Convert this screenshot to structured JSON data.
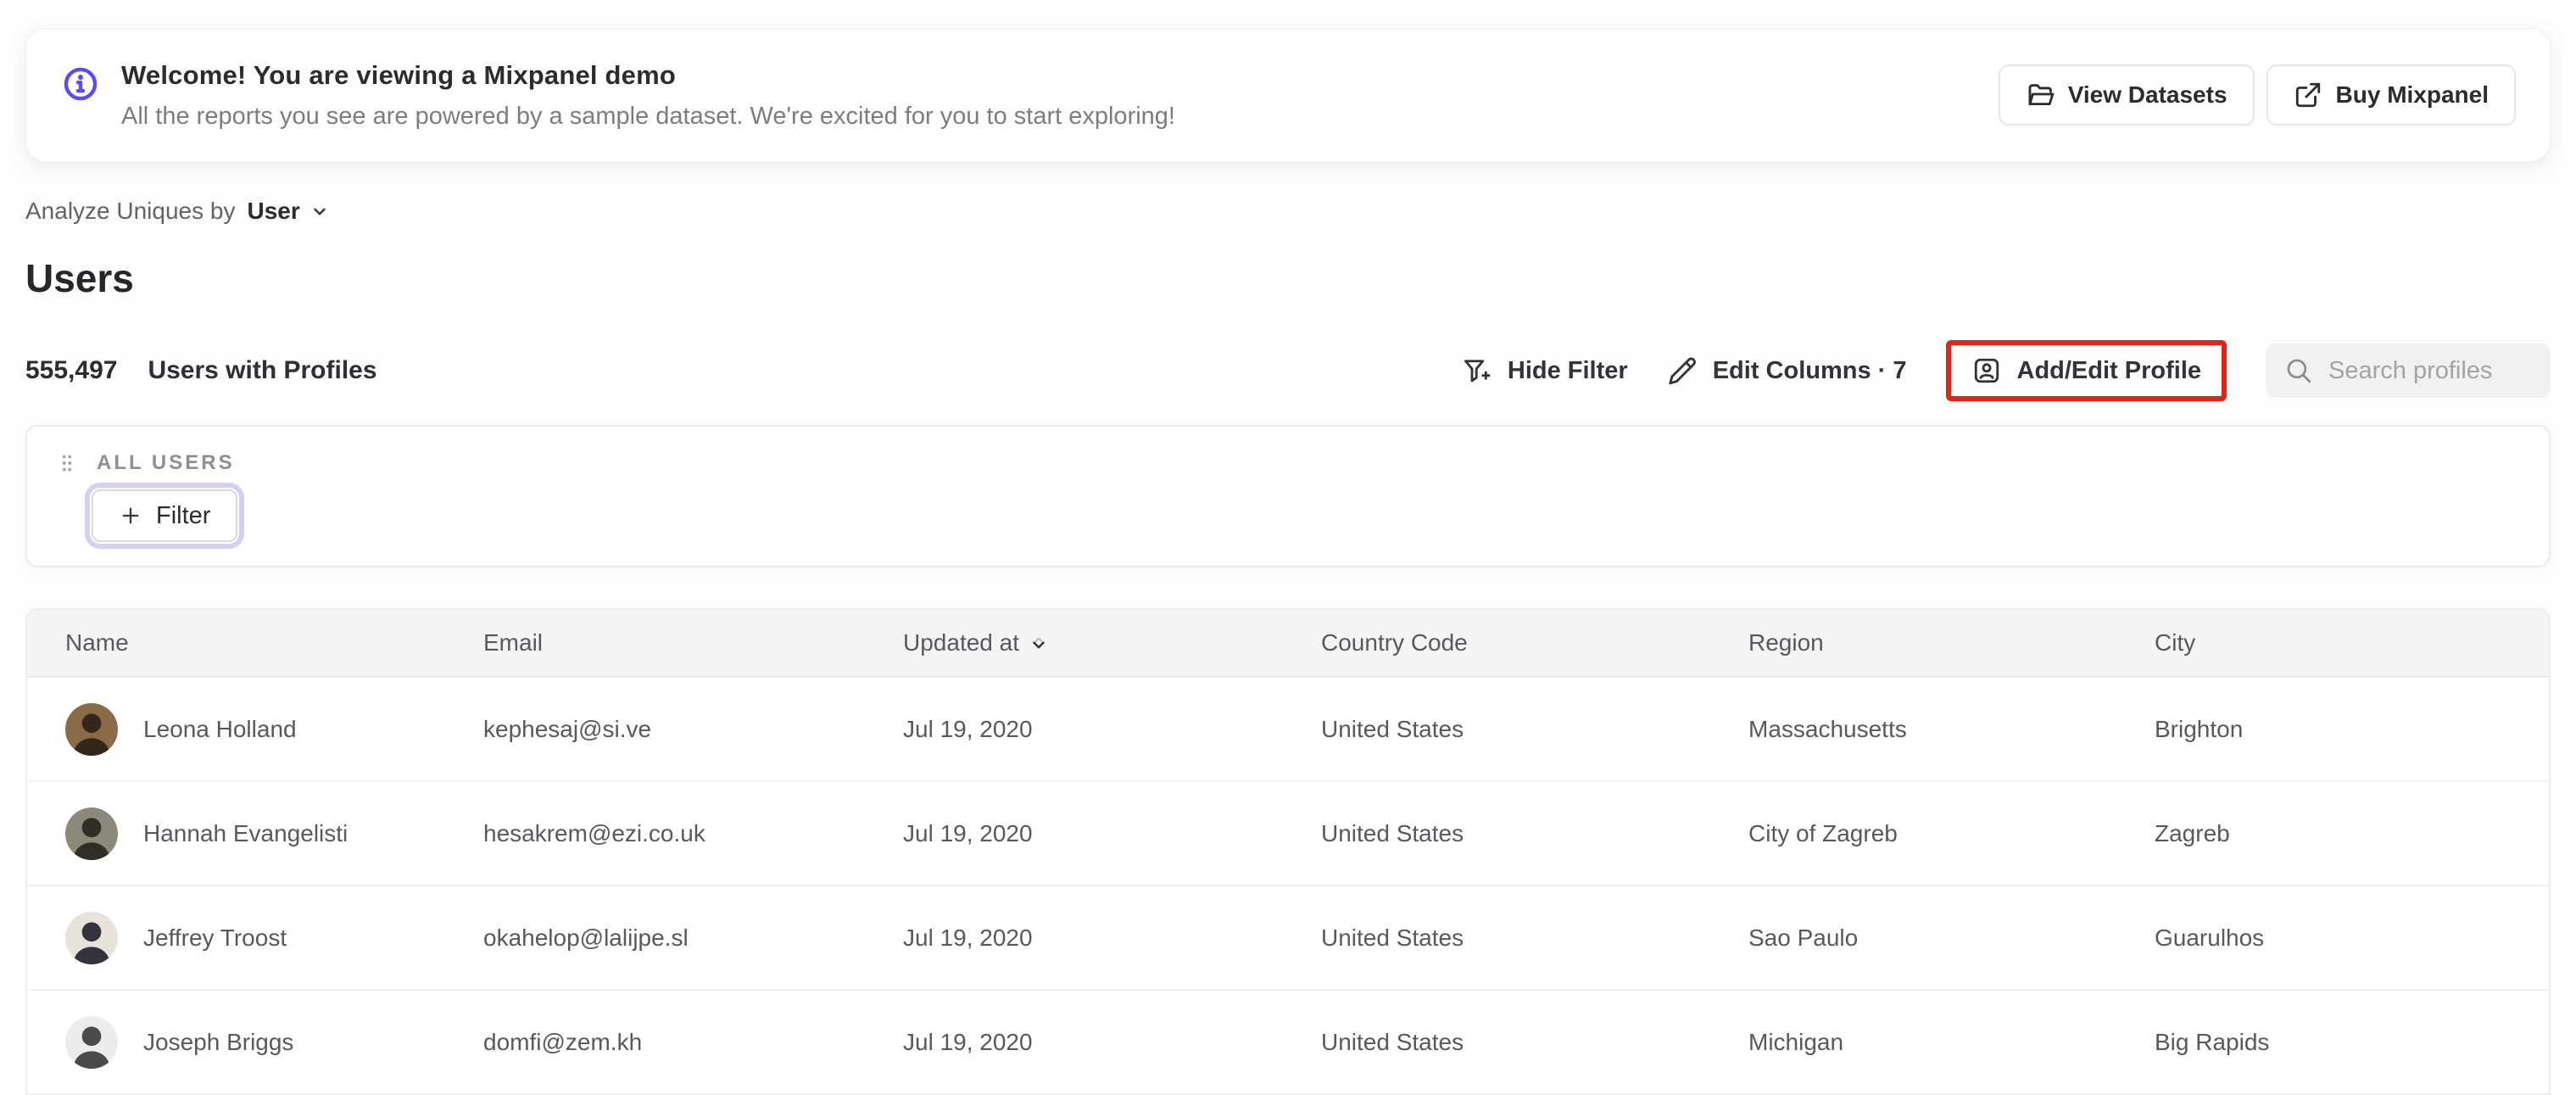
{
  "banner": {
    "title": "Welcome! You are viewing a Mixpanel demo",
    "subtitle": "All the reports you see are powered by a sample dataset. We're excited for you to start exploring!",
    "actions": [
      {
        "label": "View Datasets",
        "icon": "folder-icon"
      },
      {
        "label": "Buy Mixpanel",
        "icon": "external-link-icon"
      }
    ]
  },
  "analyze": {
    "prefix": "Analyze Uniques by",
    "selected": "User"
  },
  "page": {
    "title": "Users"
  },
  "summary": {
    "count": "555,497",
    "label": "Users with Profiles"
  },
  "toolbar": {
    "hide_filter": "Hide Filter",
    "edit_columns": "Edit Columns · 7",
    "add_edit_profile": "Add/Edit Profile",
    "search_placeholder": "Search profiles",
    "highlight_color": "#e02516"
  },
  "filter_panel": {
    "group_label": "ALL USERS",
    "add_filter_label": "Filter"
  },
  "table": {
    "columns": [
      "Name",
      "Email",
      "Updated at",
      "Country Code",
      "Region",
      "City"
    ],
    "sorted_column": "Updated at",
    "sort_direction": "desc",
    "rows": [
      {
        "name": "Leona Holland",
        "email": "kephesaj@si.ve",
        "updated_at": "Jul 19, 2020",
        "country_code": "United States",
        "region": "Massachusetts",
        "city": "Brighton",
        "avatar": {
          "bg": "#8a6b47",
          "fg": "#34271a"
        }
      },
      {
        "name": "Hannah Evangelisti",
        "email": "hesakrem@ezi.co.uk",
        "updated_at": "Jul 19, 2020",
        "country_code": "United States",
        "region": "City of Zagreb",
        "city": "Zagreb",
        "avatar": {
          "bg": "#8c887a",
          "fg": "#2f2e27"
        }
      },
      {
        "name": "Jeffrey Troost",
        "email": "okahelop@lalijpe.sl",
        "updated_at": "Jul 19, 2020",
        "country_code": "United States",
        "region": "Sao Paulo",
        "city": "Guarulhos",
        "avatar": {
          "bg": "#e8e3da",
          "fg": "#34343e"
        }
      },
      {
        "name": "Joseph Briggs",
        "email": "domfi@zem.kh",
        "updated_at": "Jul 19, 2020",
        "country_code": "United States",
        "region": "Michigan",
        "city": "Big Rapids",
        "avatar": {
          "bg": "#ececec",
          "fg": "#4a4a4a"
        }
      }
    ]
  },
  "colors": {
    "accent_purple": "#5b4ded",
    "highlight_red": "#e02516",
    "filter_focus_ring": "#d4d0f8",
    "table_header_bg": "#f4f4f5"
  }
}
